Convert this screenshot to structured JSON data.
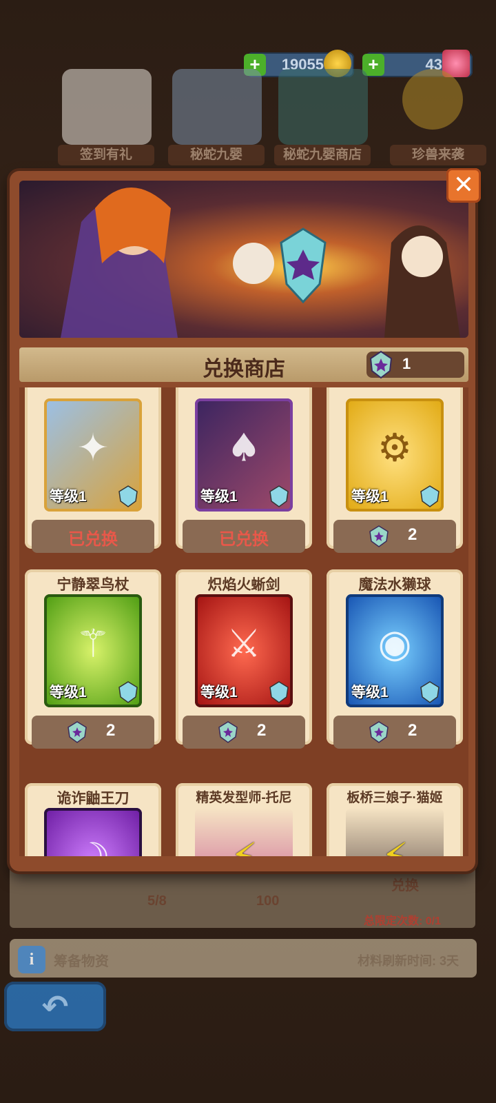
{
  "top_bar": {
    "gold": "19055",
    "gems": "43",
    "icons": [
      "签到有礼",
      "秘蛇九婴",
      "秘蛇九婴商店",
      "珍兽来袭"
    ]
  },
  "background": {
    "progress": "5/8",
    "material_count": "100",
    "exchange_label": "兑换",
    "limit_text": "总限定次数: 0/1",
    "prep_title": "筹备物资",
    "refresh_text": "材料刷新时间: 3天"
  },
  "modal": {
    "title": "兑换商店",
    "currency_count": "1",
    "close_icon": "close-icon"
  },
  "items": [
    {
      "name": "",
      "level": "等级1",
      "status": "已兑换",
      "cost": null,
      "color": "#d9a23a"
    },
    {
      "name": "",
      "level": "等级1",
      "status": "已兑换",
      "cost": null,
      "color": "#7b3fa0"
    },
    {
      "name": "",
      "level": "等级1",
      "status": null,
      "cost": "2",
      "color": "#e0a810"
    },
    {
      "name": "宁静翠鸟杖",
      "level": "等级1",
      "status": null,
      "cost": "2",
      "color": "#6bb020"
    },
    {
      "name": "炽焰火蜥剑",
      "level": "等级1",
      "status": null,
      "cost": "2",
      "color": "#c8201a"
    },
    {
      "name": "魔法水獭球",
      "level": "等级1",
      "status": null,
      "cost": "2",
      "color": "#1f6fd0"
    },
    {
      "name": "诡诈鼬王刀",
      "level": "",
      "status": null,
      "cost": null,
      "color": "#8a2fc0"
    },
    {
      "name": "精英发型师-托尼",
      "level": "",
      "status": null,
      "cost": null,
      "color": "#f3e3c6"
    },
    {
      "name": "板桥三娘子·猫姬",
      "level": "",
      "status": null,
      "cost": null,
      "color": "#f3e3c6"
    }
  ]
}
